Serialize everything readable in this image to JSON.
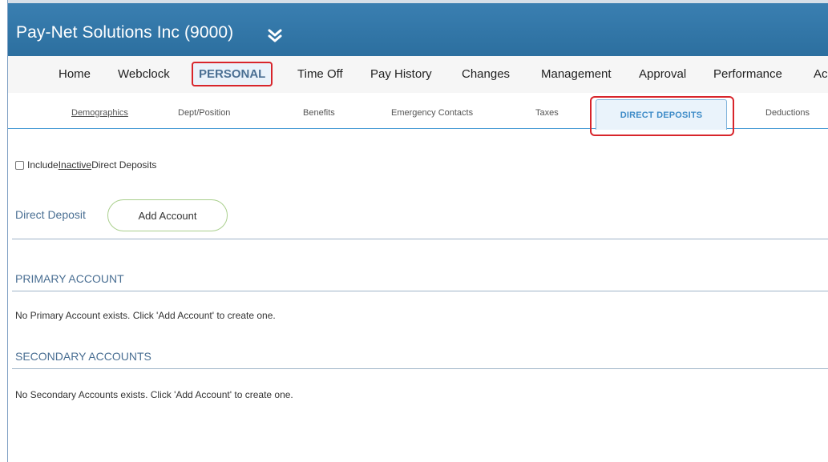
{
  "header": {
    "company": "Pay-Net Solutions Inc (9000)"
  },
  "main_nav": {
    "items": [
      {
        "label": "Home"
      },
      {
        "label": "Webclock"
      },
      {
        "label": "PERSONAL",
        "active": true
      },
      {
        "label": "Time Off"
      },
      {
        "label": "Pay History"
      },
      {
        "label": "Changes"
      },
      {
        "label": "Management"
      },
      {
        "label": "Approval"
      },
      {
        "label": "Performance"
      },
      {
        "label": "Ac"
      }
    ]
  },
  "sub_nav": {
    "items": [
      {
        "label": "Demographics"
      },
      {
        "label": "Dept/Position"
      },
      {
        "label": "Benefits"
      },
      {
        "label": "Emergency Contacts"
      },
      {
        "label": "Taxes"
      },
      {
        "label": "DIRECT DEPOSITS",
        "active": true
      },
      {
        "label": "Deductions"
      }
    ]
  },
  "content": {
    "include_pre": "Include ",
    "include_link": "Inactive",
    "include_post": " Direct Deposits",
    "direct_deposit_label": "Direct Deposit",
    "add_account_label": "Add Account",
    "primary_title": "PRIMARY ACCOUNT",
    "primary_msg": "No Primary Account exists. Click 'Add Account' to create one.",
    "secondary_title": "SECONDARY ACCOUNTS",
    "secondary_msg": "No Secondary Accounts exists. Click 'Add Account' to create one."
  },
  "colors": {
    "header_bg": "#2c6f9f",
    "highlight_outline": "#d8252b",
    "active_tab_text": "#3f8cc8"
  }
}
